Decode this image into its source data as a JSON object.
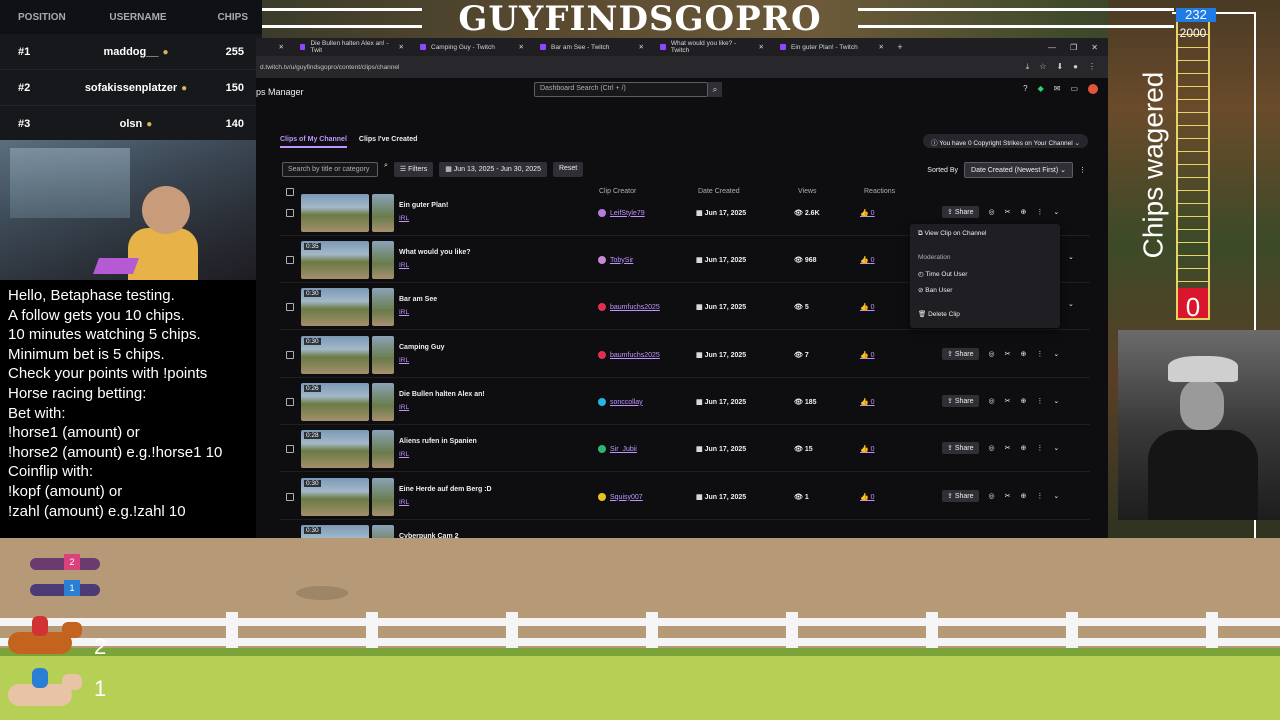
{
  "overlay": {
    "stream_title": "GUYFINDSGOPRO",
    "chips_wagered_label": "Chips wagered",
    "meter_top": "232",
    "meter_max": "2000",
    "meter_value": "0",
    "meter_fill_fraction": 0.1,
    "accent_color": "#d9162b"
  },
  "leaderboard": {
    "headers": {
      "position": "POSITION",
      "username": "USERNAME",
      "chips": "CHIPS"
    },
    "rows": [
      {
        "pos": "#1",
        "user": "maddog__",
        "chips": "255"
      },
      {
        "pos": "#2",
        "user": "sofakissenplatzer",
        "chips": "150"
      },
      {
        "pos": "#3",
        "user": "olsn",
        "chips": "140"
      }
    ]
  },
  "info_lines": [
    "Hello, Betaphase testing.",
    "A follow gets you 10 chips.",
    "10 minutes watching 5 chips.",
    "Minimum bet is 5 chips.",
    "Check your points with !points",
    "Horse racing betting:",
    "Bet with:",
    "!horse1 (amount) or",
    "!horse2 (amount) e.g.!horse1 10",
    "Coinflip with:",
    "!kopf (amount) or",
    "!zahl (amount) e.g.!zahl 10"
  ],
  "browser": {
    "tabs": [
      "Die Bullen halten Alex an! - Twit",
      "Camping Guy - Twitch",
      "Bar am See - Twitch",
      "What would you like? - Twitch",
      "Ein guter Plan! - Twitch"
    ],
    "url": "d.twitch.tv/u/guyfindsgopro/content/clips/channel",
    "app_title": "ps Manager",
    "search_placeholder": "Dashboard Search (Ctrl + /)",
    "subtab_active": "Clips of My Channel",
    "subtab_other": "Clips I've Created",
    "strikes": "You have 0 Copyright Strikes on Your Channel",
    "filter_placeholder": "Search by title or category",
    "filters_label": "Filters",
    "date_range": "Jun 13, 2025 - Jun 30, 2025",
    "reset_label": "Reset",
    "sorted_by_label": "Sorted By",
    "sort_value": "Date Created (Newest First)",
    "columns": {
      "creator": "Clip Creator",
      "date": "Date Created",
      "views": "Views",
      "reactions": "Reactions"
    },
    "share_label": "Share",
    "clips": [
      {
        "duration": "",
        "title": "Ein guter Plan!",
        "category": "IRL",
        "creator": "LeifStyle79",
        "creator_color": "#b77ae0",
        "date": "Jun 17, 2025",
        "views": "2.6K",
        "reactions": "0"
      },
      {
        "duration": "0:35",
        "title": "What would you like?",
        "category": "IRL",
        "creator": "TobySir",
        "creator_color": "#c88ad0",
        "date": "Jun 17, 2025",
        "views": "968",
        "reactions": "0"
      },
      {
        "duration": "0:30",
        "title": "Bar am See",
        "category": "IRL",
        "creator": "baumfuchs2025",
        "creator_color": "#e0314f",
        "date": "Jun 17, 2025",
        "views": "5",
        "reactions": "0"
      },
      {
        "duration": "0:30",
        "title": "Camping Guy",
        "category": "IRL",
        "creator": "baumfuchs2025",
        "creator_color": "#e0314f",
        "date": "Jun 17, 2025",
        "views": "7",
        "reactions": "0"
      },
      {
        "duration": "0:26",
        "title": "Die Bullen halten Alex an!",
        "category": "IRL",
        "creator": "sonccollay",
        "creator_color": "#23b7e5",
        "date": "Jun 17, 2025",
        "views": "185",
        "reactions": "0"
      },
      {
        "duration": "0:28",
        "title": "Aliens rufen in Spanien",
        "category": "IRL",
        "creator": "Sir_Jubii",
        "creator_color": "#2bb673",
        "date": "Jun 17, 2025",
        "views": "15",
        "reactions": "0"
      },
      {
        "duration": "0:30",
        "title": "Eine Herde auf dem Berg :D",
        "category": "IRL",
        "creator": "Squisy007",
        "creator_color": "#e8c51c",
        "date": "Jun 17, 2025",
        "views": "1",
        "reactions": "0"
      },
      {
        "duration": "0:30",
        "title": "Cyberpunk Cam 2",
        "category": "",
        "creator": "",
        "creator_color": "#888888",
        "date": "",
        "views": "",
        "reactions": ""
      }
    ],
    "menu": {
      "view": "View Clip on Channel",
      "section": "Moderation",
      "timeout": "Time Out User",
      "ban": "Ban User",
      "delete": "Delete Clip"
    }
  },
  "race": {
    "lane_2": "2",
    "lane_1": "1",
    "greyhound_top": "2",
    "greyhound_bottom": "1"
  }
}
